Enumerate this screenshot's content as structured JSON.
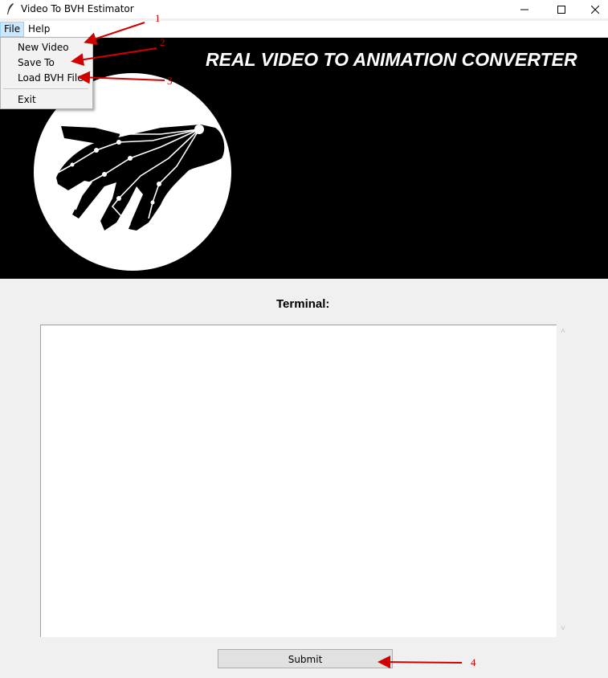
{
  "window": {
    "title": "Video To BVH Estimator",
    "minimize_glyph": "—",
    "maximize_glyph": "☐",
    "close_glyph": "✕"
  },
  "menubar": {
    "file_label": "File",
    "help_label": "Help"
  },
  "file_menu": {
    "items": [
      "New Video",
      "Save To",
      "Load BVH File",
      "Exit"
    ]
  },
  "banner": {
    "title": "REAL VIDEO TO ANIMATION CONVERTER"
  },
  "terminal": {
    "label": "Terminal:",
    "content": ""
  },
  "submit_label": "Submit",
  "annotations": [
    "1",
    "2",
    "3",
    "4"
  ],
  "colors": {
    "annotation": "#d00000",
    "menu_highlight": "#cce8ff",
    "banner_bg": "#000000"
  }
}
